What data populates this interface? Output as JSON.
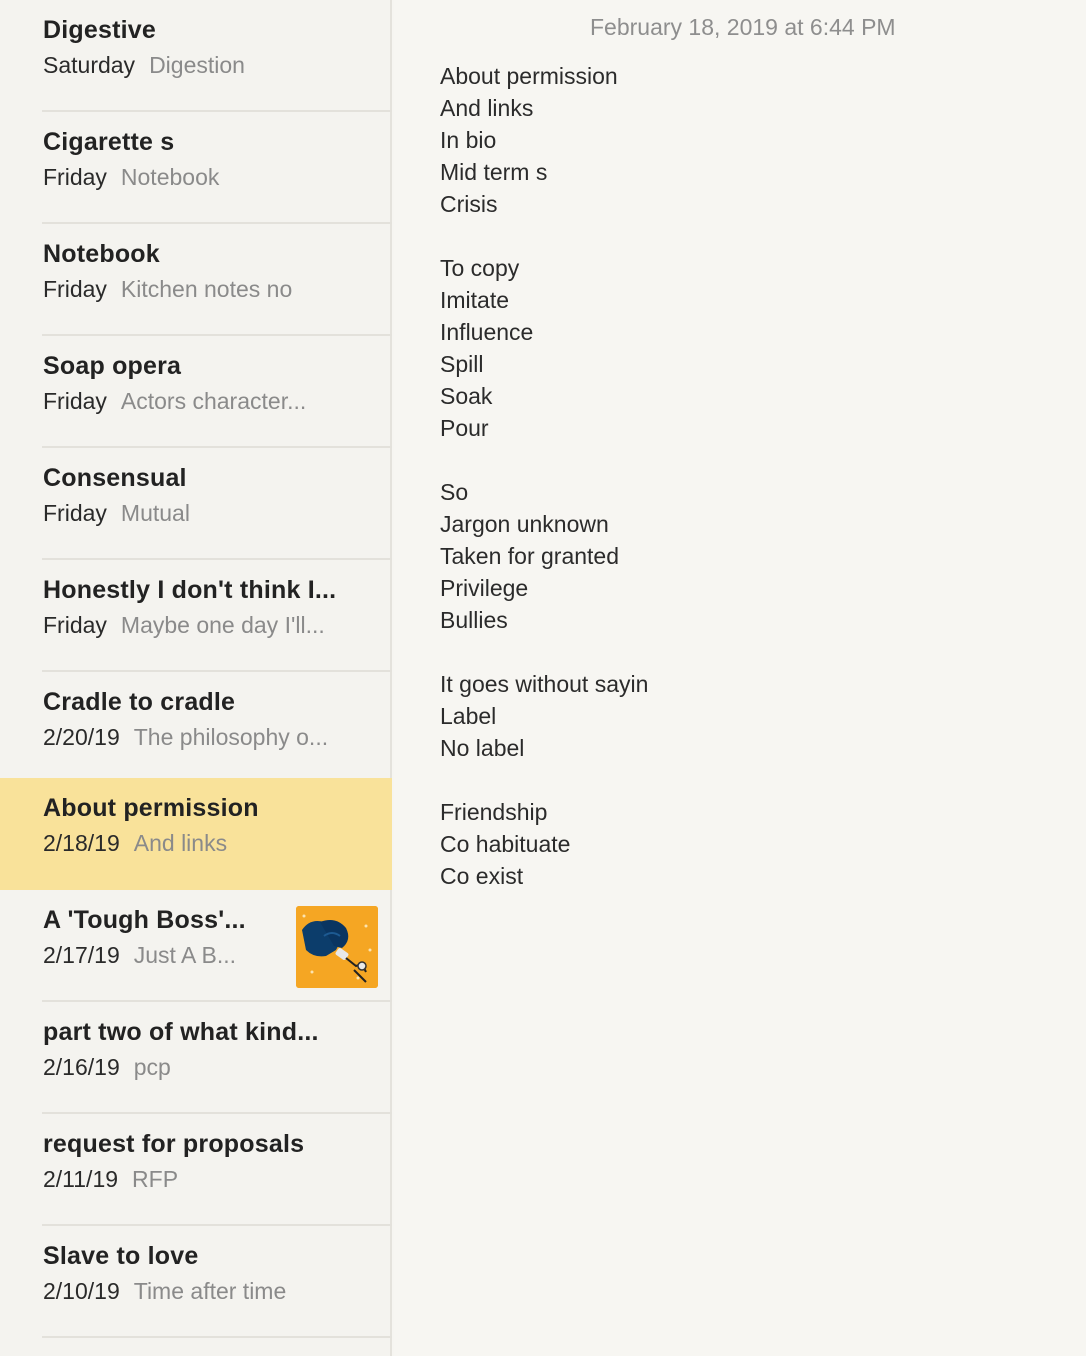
{
  "notes": [
    {
      "title": "Digestive",
      "date": "Saturday",
      "preview": "Digestion"
    },
    {
      "title": "Cigarette s",
      "date": "Friday",
      "preview": "Notebook"
    },
    {
      "title": "Notebook",
      "date": "Friday",
      "preview": "Kitchen notes no"
    },
    {
      "title": "Soap opera",
      "date": "Friday",
      "preview": "Actors character..."
    },
    {
      "title": "Consensual",
      "date": "Friday",
      "preview": "Mutual"
    },
    {
      "title": "Honestly I don't think I...",
      "date": "Friday",
      "preview": "Maybe one day I'll..."
    },
    {
      "title": "Cradle to cradle",
      "date": "2/20/19",
      "preview": "The philosophy o..."
    },
    {
      "title": "About permission",
      "date": "2/18/19",
      "preview": "And links"
    },
    {
      "title": "A 'Tough Boss'...",
      "date": "2/17/19",
      "preview": "Just A B..."
    },
    {
      "title": "part two of what kind...",
      "date": "2/16/19",
      "preview": "pcp"
    },
    {
      "title": "request for proposals",
      "date": "2/11/19",
      "preview": "RFP"
    },
    {
      "title": "Slave to love",
      "date": "2/10/19",
      "preview": "Time after time"
    }
  ],
  "selected_index": 7,
  "selected_color": "#f9e29a",
  "detail": {
    "date": "February 18, 2019 at 6:44 PM",
    "lines": [
      "About permission",
      "And links",
      "In bio",
      "Mid term s",
      "Crisis",
      "",
      "To copy",
      "Imitate",
      "Influence",
      "Spill",
      "Soak",
      "Pour",
      "",
      "So",
      "Jargon unknown",
      "Taken for granted",
      "Privilege",
      "Bullies",
      "",
      "It goes without sayin",
      "Label",
      "No label",
      "",
      "Friendship",
      "Co habituate",
      "Co exist"
    ]
  }
}
